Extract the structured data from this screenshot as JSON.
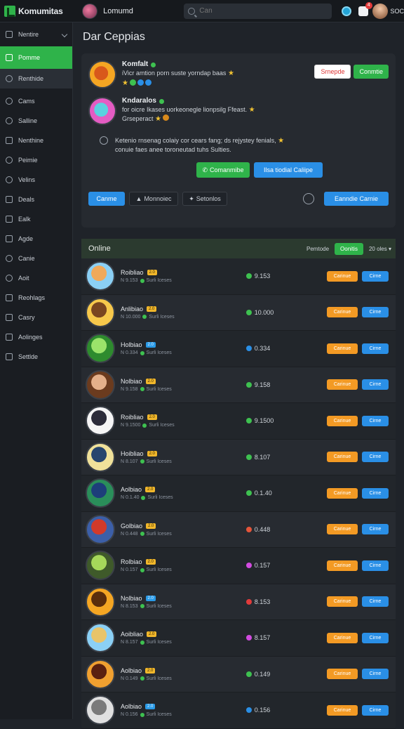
{
  "topbar": {
    "brand": "Komumitas",
    "title": "Lomumd",
    "search_placeholder": "Can",
    "notif_count": "4",
    "user_name": "SOC",
    "icons": [
      "globe-icon",
      "notification-icon"
    ]
  },
  "sidebar": {
    "items": [
      {
        "label": "Nentire",
        "icon": "grid-icon"
      },
      {
        "label": "Pomme",
        "icon": "home-icon"
      },
      {
        "label": "Renthide",
        "icon": "clock-icon"
      },
      {
        "label": "Cams",
        "icon": "camera-icon"
      },
      {
        "label": "Salline",
        "icon": "settings-icon"
      },
      {
        "label": "Nenthine",
        "icon": "news-icon"
      },
      {
        "label": "Peimie",
        "icon": "phone-icon"
      },
      {
        "label": "Velins",
        "icon": "shield-icon"
      },
      {
        "label": "Deals",
        "icon": "tag-icon"
      },
      {
        "label": "Ealk",
        "icon": "chat-icon"
      },
      {
        "label": "Agde",
        "icon": "calendar-icon"
      },
      {
        "label": "Canie",
        "icon": "circle-icon"
      },
      {
        "label": "Aoit",
        "icon": "call-icon"
      },
      {
        "label": "Reohlags",
        "icon": "flag-icon"
      },
      {
        "label": "Casry",
        "icon": "box-icon"
      },
      {
        "label": "Aolinges",
        "icon": "list-icon"
      },
      {
        "label": "Settlde",
        "icon": "gear-icon"
      }
    ]
  },
  "main": {
    "page_title": "Dar Ceppias",
    "posts": [
      {
        "name": "Komfalt",
        "text": "iVicr amtion porn suste yorndap baas",
        "colors": [
          "#f5a623",
          "#d8581b"
        ]
      },
      {
        "name": "Kndaralos",
        "text1": "for oicre Ikases uorkeonegle lionpsilg Ffeast.",
        "text2": "Grseperact",
        "colors": [
          "#e45cc3",
          "#5ad1e0"
        ]
      }
    ],
    "notice": {
      "line1": "Ketenio rnsenag colaiy cor cears fang; ds rejystey fenials,",
      "line2": "conuie faes anee toroneutad tuhs Sulties."
    },
    "post_actions": {
      "report": "Srnepde",
      "comment": "Conmtie"
    },
    "mid_actions": {
      "primary": "Comanmibe",
      "secondary": "Ilsa tiodial Caliipe"
    },
    "footer_actions": {
      "one": "Canme",
      "two": "Monnoiec",
      "three": "Setonlos",
      "right": "Eanndie Carnie"
    }
  },
  "online": {
    "title": "Online",
    "tab1": "Pemtode",
    "tab2": "Oonitis",
    "sort": "20 oles",
    "btn_orange": "Carinue",
    "btn_blue": "Cirne",
    "rows": [
      {
        "name": "Roibliao",
        "level": "2.0",
        "sub": "Surli Iceses",
        "score": "9.153",
        "dot": "#3ec150",
        "lvl_blue": false,
        "colors": [
          "#8bd0f5",
          "#f0a95b"
        ]
      },
      {
        "name": "Anlibiao",
        "level": "2.0",
        "sub": "Surli Iceses",
        "score": "10.000",
        "dot": "#3ec150",
        "lvl_blue": false,
        "colors": [
          "#f7c84b",
          "#7a4520"
        ]
      },
      {
        "name": "Holbiao",
        "level": "2.0",
        "sub": "Surli Iceses",
        "score": "0.334",
        "dot": "#2a8fe6",
        "lvl_blue": true,
        "colors": [
          "#2e8b2e",
          "#9be36a"
        ]
      },
      {
        "name": "Nolbiao",
        "level": "2.0",
        "sub": "Surli Iceses",
        "score": "9.158",
        "dot": "#3ec150",
        "lvl_blue": false,
        "colors": [
          "#6b3b1e",
          "#e4b08a"
        ]
      },
      {
        "name": "Roibliao",
        "level": "2.0",
        "sub": "Surli Iceses",
        "score": "9.1500",
        "dot": "#3ec150",
        "lvl_blue": false,
        "colors": [
          "#f5f5f5",
          "#2c2c3a"
        ]
      },
      {
        "name": "Hoibliao",
        "level": "2.0",
        "sub": "Surli Iceses",
        "score": "8.107",
        "dot": "#3ec150",
        "lvl_blue": false,
        "colors": [
          "#f0e19a",
          "#27456e"
        ]
      },
      {
        "name": "Aolbiao",
        "level": "2.0",
        "sub": "Surli Iceses",
        "score": "0.1.40",
        "dot": "#3ec150",
        "lvl_blue": false,
        "colors": [
          "#2a8e5a",
          "#1d3e7a"
        ]
      },
      {
        "name": "Golbiao",
        "level": "2.0",
        "sub": "Surli Iceses",
        "score": "0.448",
        "dot": "#e4553a",
        "lvl_blue": false,
        "colors": [
          "#3c5fa8",
          "#d23a2a"
        ]
      },
      {
        "name": "Rolbiao",
        "level": "2.0",
        "sub": "Surli Iceses",
        "score": "0.157",
        "dot": "#d24be0",
        "lvl_blue": false,
        "colors": [
          "#3f5a2a",
          "#a6d85a"
        ]
      },
      {
        "name": "Nolbiao",
        "level": "2.0",
        "sub": "Surli Iceses",
        "score": "8.153",
        "dot": "#e23b3b",
        "lvl_blue": true,
        "colors": [
          "#f5a623",
          "#5a2d0c"
        ]
      },
      {
        "name": "Aoibliao",
        "level": "2.0",
        "sub": "Surli Iceses",
        "score": "8.157",
        "dot": "#d24be0",
        "lvl_blue": false,
        "colors": [
          "#8bd0f5",
          "#e8c46a"
        ]
      },
      {
        "name": "Aolbiao",
        "level": "2.0",
        "sub": "Surli Iceses",
        "score": "0.149",
        "dot": "#3ec150",
        "lvl_blue": false,
        "colors": [
          "#f0a030",
          "#5a2010"
        ]
      },
      {
        "name": "Aolbiao",
        "level": "2.0",
        "sub": "Surli Iceses",
        "score": "0.156",
        "dot": "#2a8fe6",
        "lvl_blue": true,
        "colors": [
          "#e0e0e0",
          "#7a7a7a"
        ]
      }
    ]
  },
  "colors": {
    "accent_green": "#2fb34a",
    "accent_blue": "#2a8fe6",
    "accent_orange": "#f39a24"
  }
}
